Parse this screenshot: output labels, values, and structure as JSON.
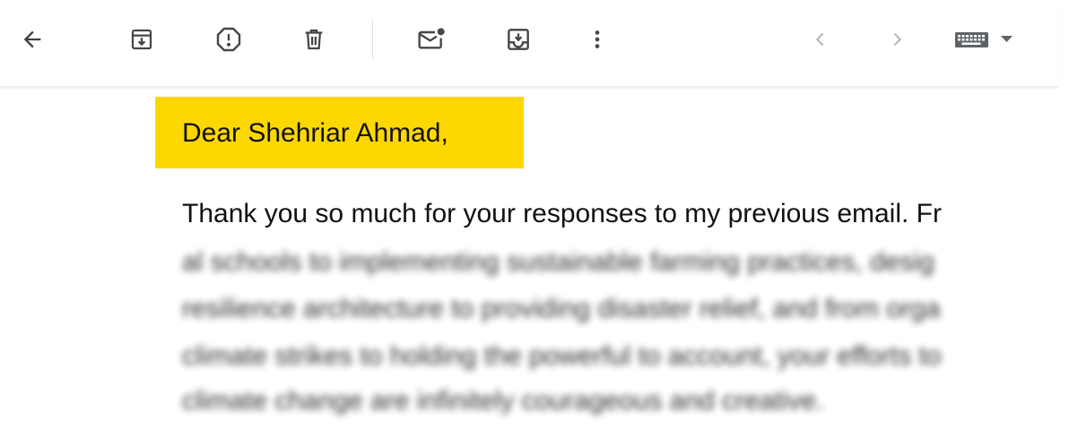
{
  "toolbar": {
    "icons": {
      "back": "arrow-left-icon",
      "archive": "archive-icon",
      "spam": "report-spam-icon",
      "delete": "trash-icon",
      "unread": "mark-unread-icon",
      "move": "move-to-icon",
      "more": "more-vert-icon",
      "prev": "chevron-left-icon",
      "next": "chevron-right-icon",
      "keyboard": "keyboard-icon"
    },
    "icon_color": "#5f6368",
    "disabled_icon_color": "#c4c7c5"
  },
  "email": {
    "greeting": "Dear Shehriar Ahmad,",
    "highlight_color": "#fdd800",
    "first_line": "Thank you so much for your responses to my previous email. Fr",
    "blurred_lines": [
      "al schools to implementing sustainable farming practices, desig",
      "resilience architecture to providing disaster relief, and from orga",
      "climate strikes to holding the powerful to account, your efforts to",
      "climate change are infinitely courageous and creative."
    ]
  }
}
